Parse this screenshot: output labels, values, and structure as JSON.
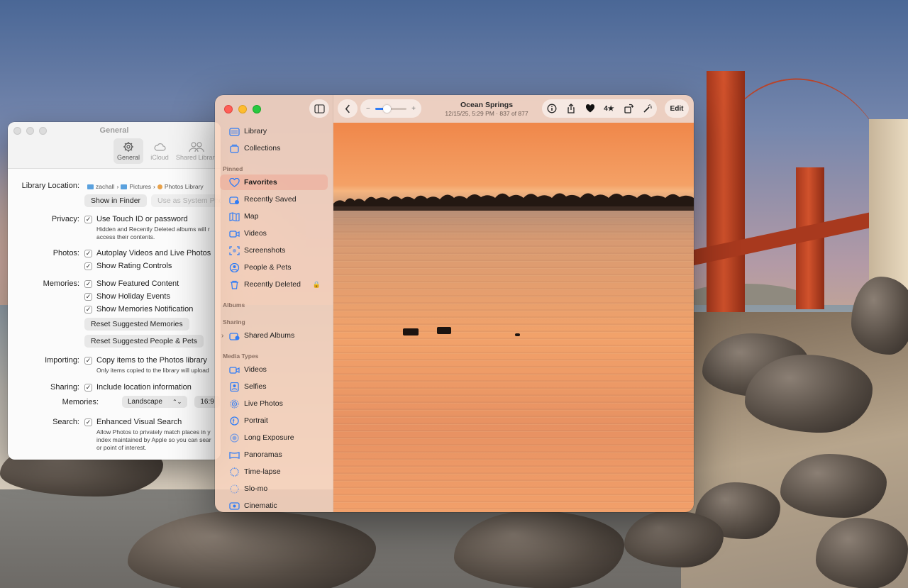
{
  "settings": {
    "title": "General",
    "tabs": [
      {
        "label": "General",
        "icon": "gear-icon"
      },
      {
        "label": "iCloud",
        "icon": "cloud-icon"
      },
      {
        "label": "Shared Librar",
        "icon": "people-icon"
      }
    ],
    "library_location": {
      "label": "Library Location:",
      "path": [
        "zachall",
        "Pictures",
        "Photos Library"
      ],
      "show_in_finder": "Show in Finder",
      "use_as_system": "Use as System Pho"
    },
    "privacy": {
      "label": "Privacy:",
      "option": "Use Touch ID or password",
      "sub1": "Hidden and Recently Deleted albums will r",
      "sub2": "access their contents."
    },
    "photos": {
      "label": "Photos:",
      "opt1": "Autoplay Videos and Live Photos",
      "opt2": "Show Rating Controls"
    },
    "memories": {
      "label": "Memories:",
      "opt1": "Show Featured Content",
      "opt2": "Show Holiday Events",
      "opt3": "Show Memories Notification",
      "reset1": "Reset Suggested Memories",
      "reset2": "Reset Suggested People & Pets"
    },
    "importing": {
      "label": "Importing:",
      "option": "Copy items to the Photos library",
      "sub": "Only items copied to the library will upload"
    },
    "sharing": {
      "label": "Sharing:",
      "option": "Include location information",
      "memories_label": "Memories:",
      "orientation": "Landscape",
      "ratio": "16:9"
    },
    "search": {
      "label": "Search:",
      "option": "Enhanced Visual Search",
      "sub1": "Allow Photos to privately match places in y",
      "sub2": "index maintained by Apple so you can sear",
      "sub3": "or point of interest."
    }
  },
  "photos_app": {
    "sidebar": {
      "top": [
        {
          "label": "Library",
          "icon": "library-icon"
        },
        {
          "label": "Collections",
          "icon": "collections-icon"
        }
      ],
      "pinned_header": "Pinned",
      "pinned": [
        {
          "label": "Favorites",
          "icon": "heart-icon",
          "selected": true
        },
        {
          "label": "Recently Saved",
          "icon": "recently-saved-icon"
        },
        {
          "label": "Map",
          "icon": "map-icon"
        },
        {
          "label": "Videos",
          "icon": "video-icon"
        },
        {
          "label": "Screenshots",
          "icon": "screenshot-icon"
        },
        {
          "label": "People & Pets",
          "icon": "person-icon"
        },
        {
          "label": "Recently Deleted",
          "icon": "trash-icon"
        }
      ],
      "albums_header": "Albums",
      "sharing_header": "Sharing",
      "shared_albums": "Shared Albums",
      "media_header": "Media Types",
      "media": [
        {
          "label": "Videos",
          "icon": "video-icon"
        },
        {
          "label": "Selfies",
          "icon": "selfie-icon"
        },
        {
          "label": "Live Photos",
          "icon": "live-photo-icon"
        },
        {
          "label": "Portrait",
          "icon": "portrait-icon"
        },
        {
          "label": "Long Exposure",
          "icon": "long-exposure-icon"
        },
        {
          "label": "Panoramas",
          "icon": "panorama-icon"
        },
        {
          "label": "Time-lapse",
          "icon": "timelapse-icon"
        },
        {
          "label": "Slo-mo",
          "icon": "slomo-icon"
        },
        {
          "label": "Cinematic",
          "icon": "cinematic-icon"
        }
      ]
    },
    "toolbar": {
      "title": "Ocean Springs",
      "subtitle": "12/15/25, 5:29 PM  ·  837 of 877",
      "zoom_minus": "−",
      "zoom_plus": "+",
      "rating": "4★",
      "edit": "Edit"
    }
  },
  "colors": {
    "accent": "#2f7cf6",
    "sidebar_bg": "#f8d4be",
    "red": "#ff5f57",
    "yellow": "#febc2e",
    "green": "#28c840"
  }
}
